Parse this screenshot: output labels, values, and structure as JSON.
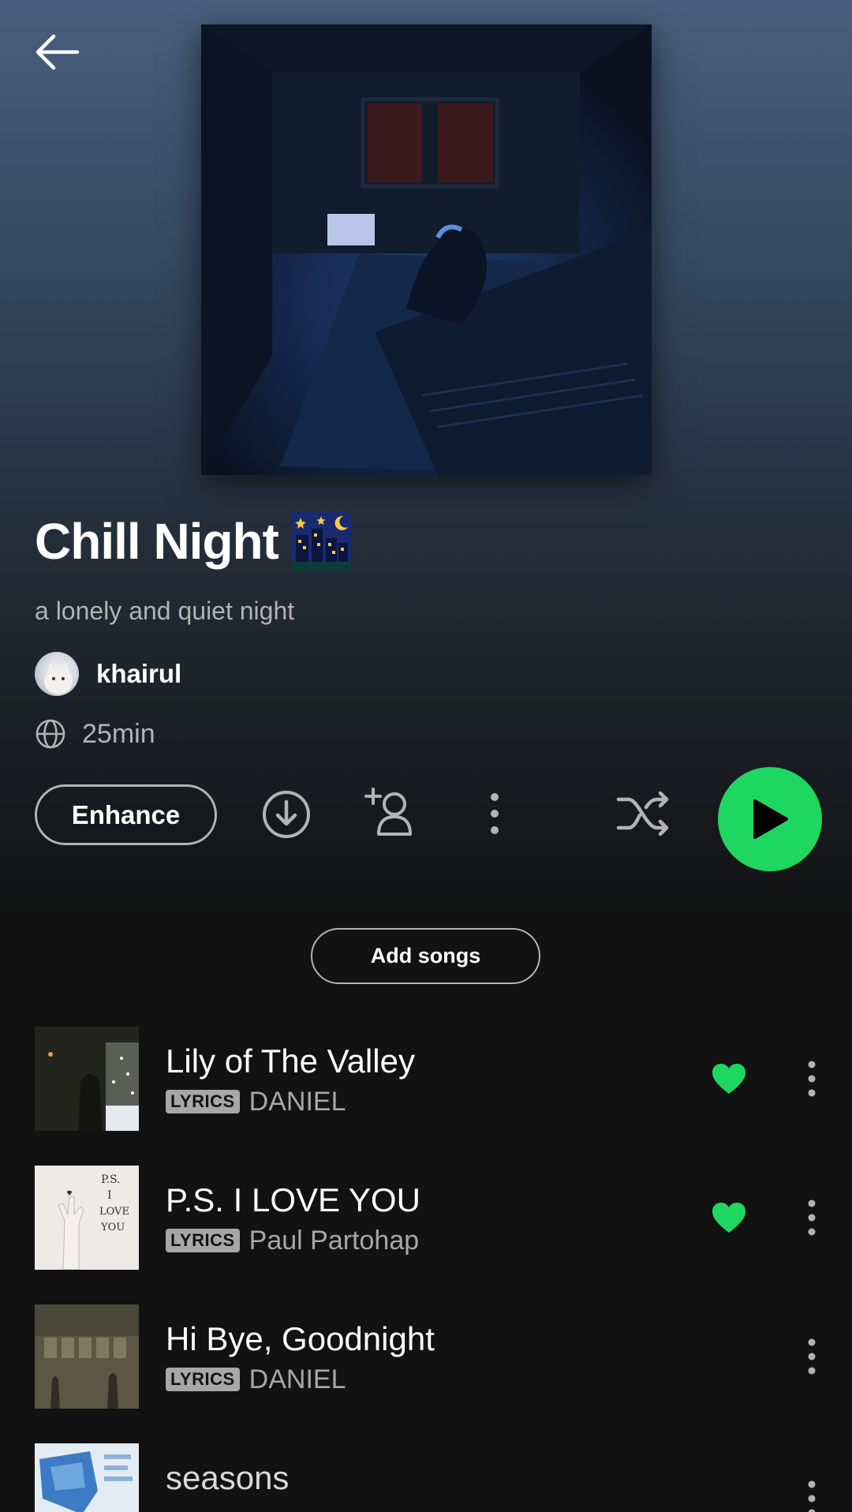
{
  "playlist": {
    "title": "Chill Night",
    "description": "a lonely and quiet night",
    "owner": "khairul",
    "duration": "25min"
  },
  "actions": {
    "enhance_label": "Enhance",
    "add_songs_label": "Add songs"
  },
  "tracks": [
    {
      "title": "Lily of The Valley",
      "badge": "LYRICS",
      "artist": "DANIEL",
      "liked": true
    },
    {
      "title": "P.S. I LOVE YOU",
      "badge": "LYRICS",
      "artist": "Paul Partohap",
      "liked": true
    },
    {
      "title": "Hi Bye, Goodnight",
      "badge": "LYRICS",
      "artist": "DANIEL",
      "liked": false
    },
    {
      "title": "seasons",
      "badge": "",
      "artist": "",
      "liked": false
    }
  ],
  "colors": {
    "accent": "#1ed760",
    "background": "#121212",
    "header_gradient_top": "#4a5f7d",
    "secondary_text": "#b3b3b3"
  },
  "icons": [
    "back-arrow-icon",
    "globe-icon",
    "download-icon",
    "add-user-icon",
    "more-vertical-icon",
    "shuffle-icon",
    "play-icon",
    "heart-icon"
  ]
}
